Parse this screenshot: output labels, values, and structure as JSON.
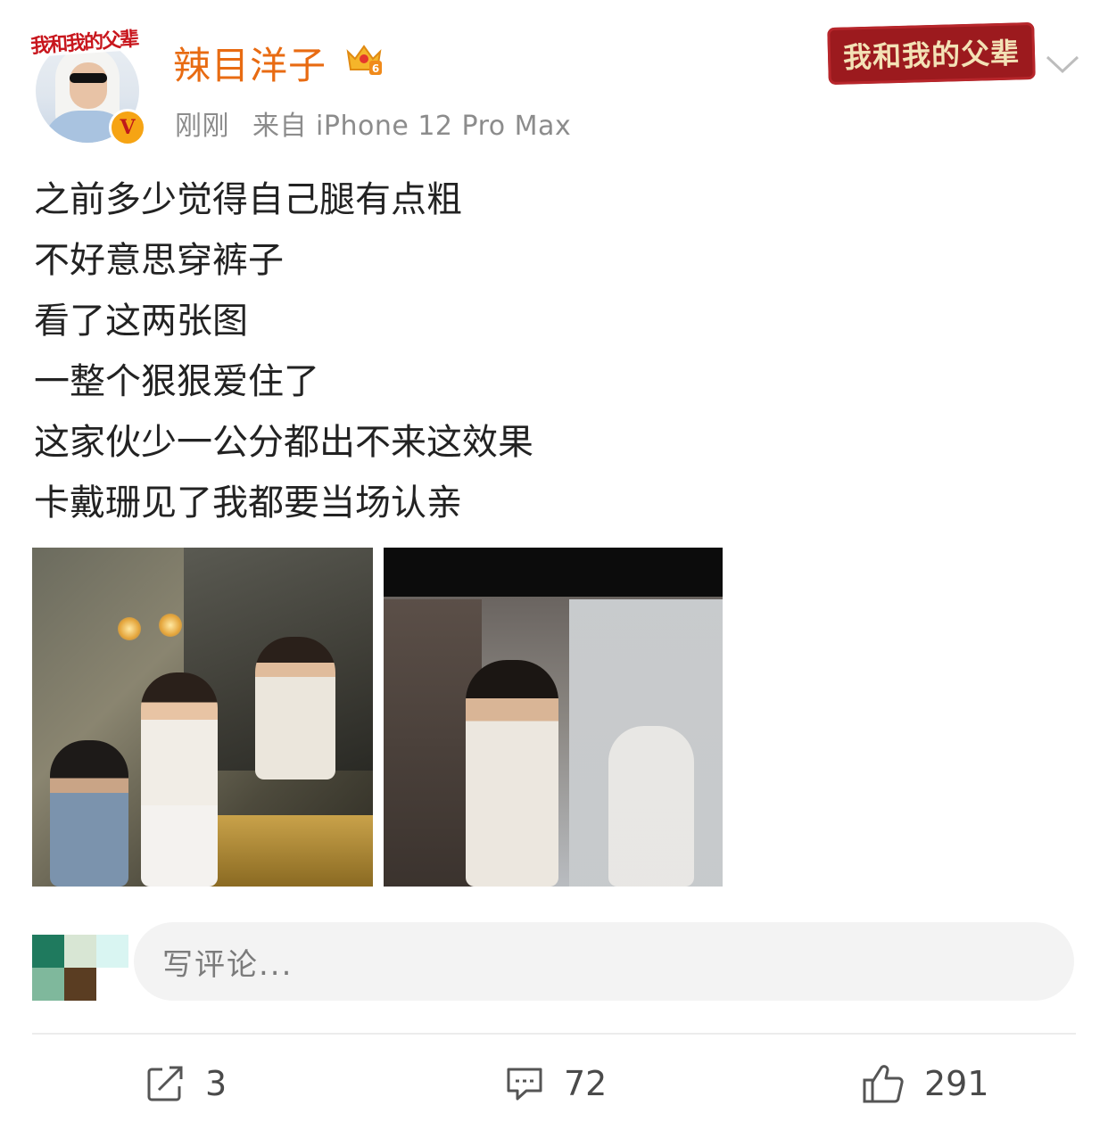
{
  "post": {
    "author": {
      "name": "辣目洋子",
      "avatar_banner": "我和我的父辈",
      "verified_badge": "V",
      "crown_level": "6"
    },
    "meta": {
      "time": "刚刚",
      "source": "来自 iPhone 12 Pro Max"
    },
    "campaign_banner": "我和我的父辈",
    "text_lines": [
      "之前多少觉得自己腿有点粗",
      "不好意思穿裤子",
      "看了这两张图",
      "一整个狠狠爱住了",
      "这家伙少一公分都出不来这效果",
      "卡戴珊见了我都要当场认亲"
    ],
    "images": [
      "photo-bathroom-mirror",
      "photo-glass-door"
    ]
  },
  "comment_box": {
    "placeholder": "写评论..."
  },
  "actions": {
    "repost": {
      "icon": "share-icon",
      "count": "3"
    },
    "comment": {
      "icon": "comment-icon",
      "count": "72"
    },
    "like": {
      "icon": "thumbs-up-icon",
      "count": "291"
    }
  },
  "colors": {
    "username": "#e86b12",
    "meta_gray": "#8c8c8c",
    "banner_red": "#9c1a1e",
    "input_bg": "#f3f3f3"
  }
}
